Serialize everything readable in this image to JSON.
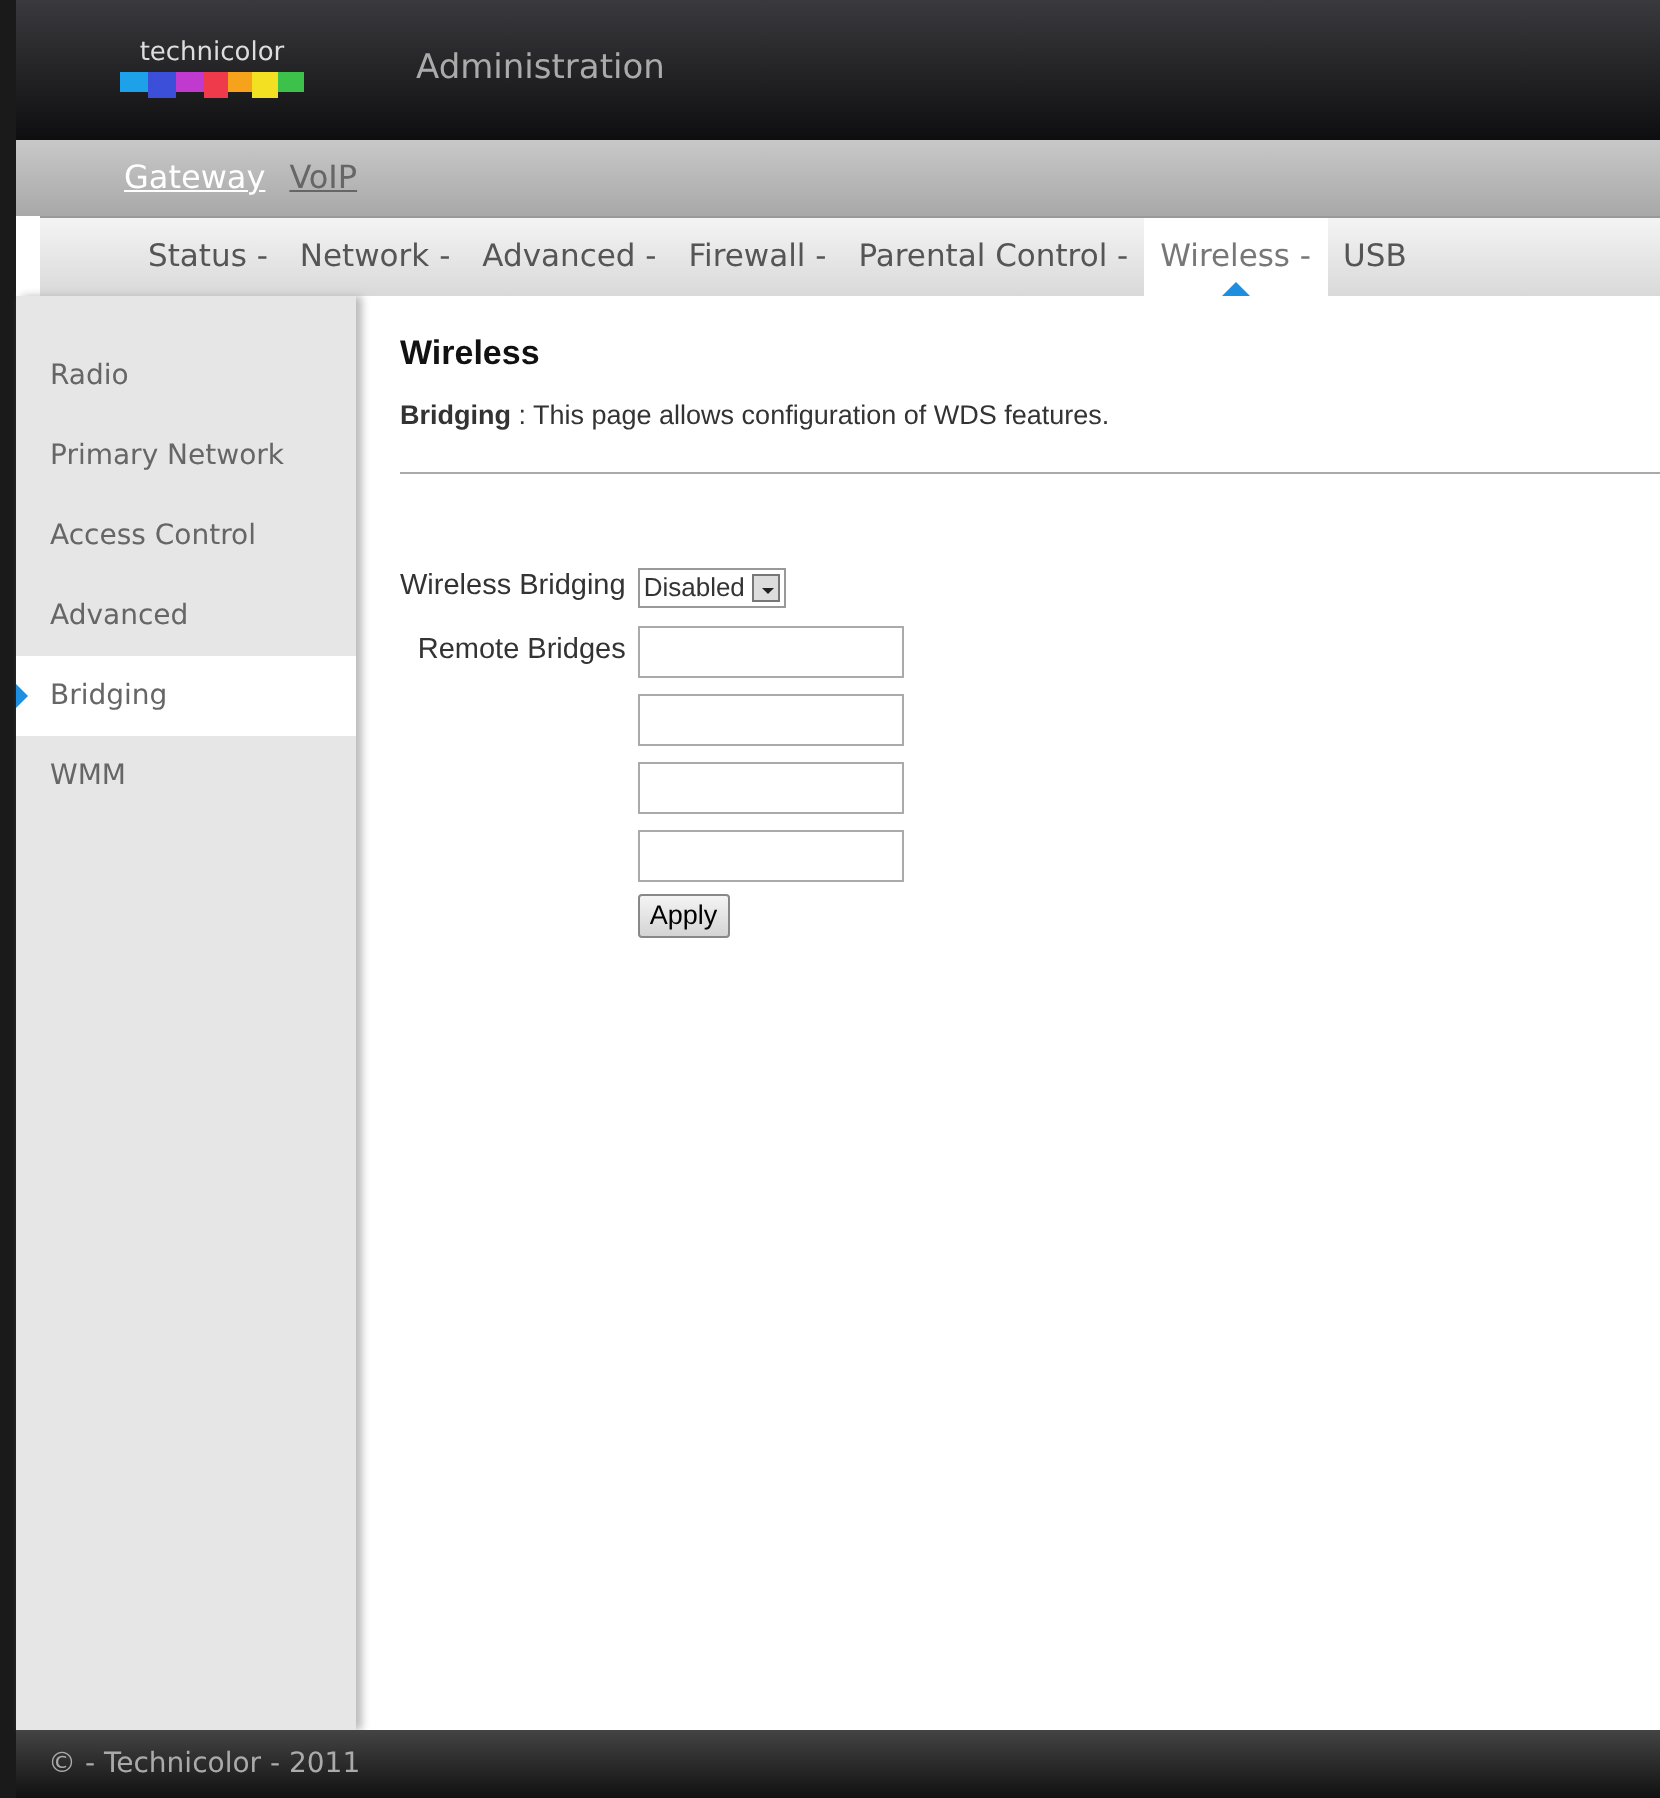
{
  "header": {
    "logo_text": "technicolor",
    "title": "Administration"
  },
  "top_nav": [
    {
      "label": "Gateway",
      "selected": true
    },
    {
      "label": "VoIP",
      "selected": false
    }
  ],
  "tabs": [
    {
      "label": "Status -",
      "selected": false
    },
    {
      "label": "Network -",
      "selected": false
    },
    {
      "label": "Advanced -",
      "selected": false
    },
    {
      "label": "Firewall -",
      "selected": false
    },
    {
      "label": "Parental Control -",
      "selected": false
    },
    {
      "label": "Wireless -",
      "selected": true
    },
    {
      "label": "USB",
      "selected": false
    }
  ],
  "sidebar": {
    "items": [
      {
        "label": "Radio",
        "selected": false
      },
      {
        "label": "Primary Network",
        "selected": false
      },
      {
        "label": "Access Control",
        "selected": false
      },
      {
        "label": "Advanced",
        "selected": false
      },
      {
        "label": "Bridging",
        "selected": true
      },
      {
        "label": "WMM",
        "selected": false
      }
    ]
  },
  "content": {
    "title": "Wireless",
    "description": "**Bridging** : This page allows configuration of WDS features.",
    "wireless_bridging": {
      "label": "Wireless Bridging",
      "value": "Disabled"
    },
    "remote_bridges": {
      "label": "Remote Bridges",
      "fields": [
        {
          "kind": "text"
        },
        {
          "kind": "text"
        },
        {
          "kind": "text"
        },
        {
          "kind": "text"
        }
      ]
    },
    "button": "Apply"
  },
  "footer": "© - Technicolor - 2011"
}
